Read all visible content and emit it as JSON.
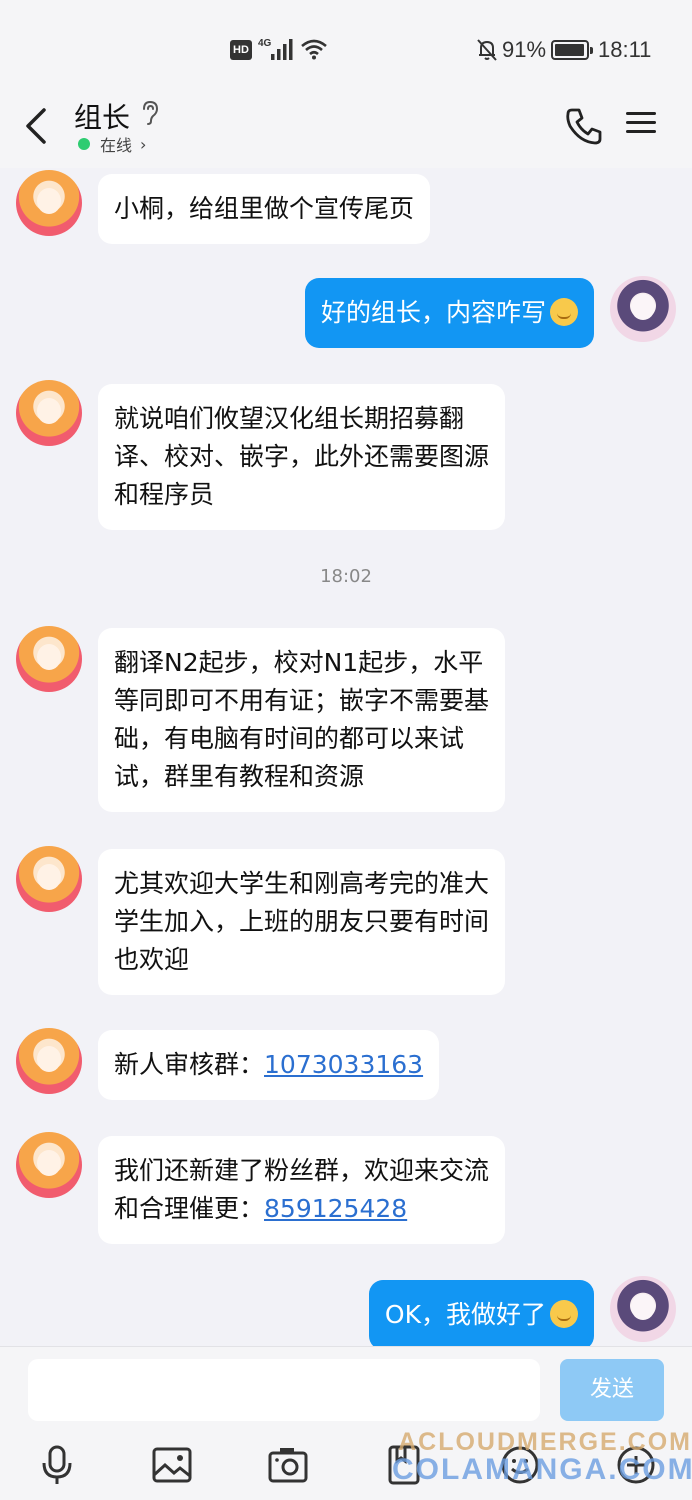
{
  "status_bar": {
    "hd": "HD",
    "network": "4G",
    "battery_percent": "91%",
    "battery_level": 0.91,
    "time": "18:11",
    "icons": [
      "hd-icon",
      "signal-icon",
      "wifi-icon",
      "bell-muted-icon",
      "battery-icon"
    ]
  },
  "header": {
    "contact_name": "组长",
    "presence": "在线",
    "icons": [
      "back-arrow-icon",
      "ear-icon",
      "phone-icon",
      "menu-icon"
    ]
  },
  "messages": [
    {
      "side": "in",
      "text": "小桐，给组里做个宣传尾页"
    },
    {
      "side": "out",
      "text": "好的组长，内容咋写",
      "emoji": "smile-emoji"
    },
    {
      "side": "in",
      "lines": [
        "就说咱们攸望汉化组长期招募翻",
        "译、校对、嵌字，此外还需要图源",
        "和程序员"
      ]
    },
    {
      "type": "timestamp",
      "text": "18:02"
    },
    {
      "side": "in",
      "lines": [
        "翻译N2起步，校对N1起步，水平",
        "等同即可不用有证；嵌字不需要基",
        "础，有电脑有时间的都可以来试",
        "试，群里有教程和资源"
      ]
    },
    {
      "side": "in",
      "lines": [
        "尤其欢迎大学生和刚高考完的准大",
        "学生加入，上班的朋友只要有时间",
        "也欢迎"
      ]
    },
    {
      "side": "in",
      "prefix": "新人审核群：",
      "link": "1073033163"
    },
    {
      "side": "in",
      "line1": "我们还新建了粉丝群，欢迎来交流",
      "prefix": "和合理催更：",
      "link": "859125428"
    },
    {
      "side": "out",
      "text": "OK，我做好了",
      "emoji": "wink-emoji"
    }
  ],
  "input": {
    "placeholder": "",
    "send_label": "发送",
    "tools": [
      "mic-icon",
      "image-icon",
      "camera-icon",
      "file-icon",
      "emoji-icon",
      "plus-icon"
    ]
  },
  "watermark": {
    "line1": "ACLOUDMERGE.COM",
    "line2": "COLAMANGA.COM"
  },
  "colors": {
    "outgoing_bubble": "#1296f3",
    "incoming_bubble": "#ffffff",
    "background": "#f2f2f7",
    "link": "#2b6fd0",
    "online_dot": "#2ecc71",
    "send_button": "#8ec9f5"
  }
}
